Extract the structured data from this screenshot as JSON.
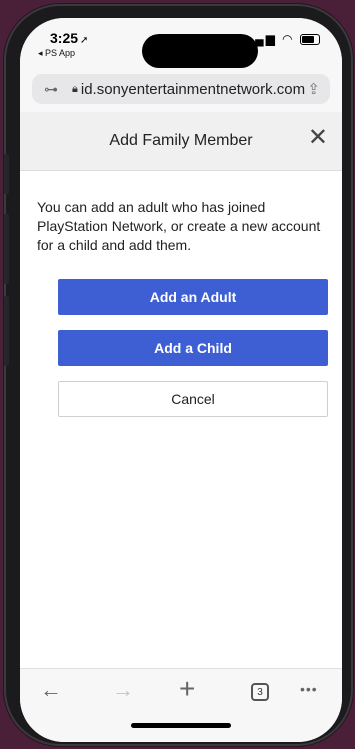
{
  "status_bar": {
    "time": "3:25",
    "location_glyph": "➚",
    "back_app": "◂ PS App",
    "icons": [
      "cellular-signal-icon",
      "wifi-icon",
      "battery-icon"
    ]
  },
  "browser": {
    "url": "id.sonyentertainmentnetwork.com",
    "key_icon": "key-icon",
    "lock_icon": "lock-icon",
    "share_icon": "share-icon"
  },
  "dialog": {
    "title": "Add Family Member",
    "close_label": "✕",
    "description": "You can add an adult who has joined PlayStation Network, or create a new account for a child and add them.",
    "buttons": {
      "add_adult": "Add an Adult",
      "add_child": "Add a Child",
      "cancel": "Cancel"
    }
  },
  "toolbar": {
    "back": "←",
    "forward": "→",
    "new_tab": "+",
    "tabs_count": "3",
    "more": "•••"
  },
  "colors": {
    "primary_button": "#3e5fd4",
    "background": "#4a1f38"
  }
}
